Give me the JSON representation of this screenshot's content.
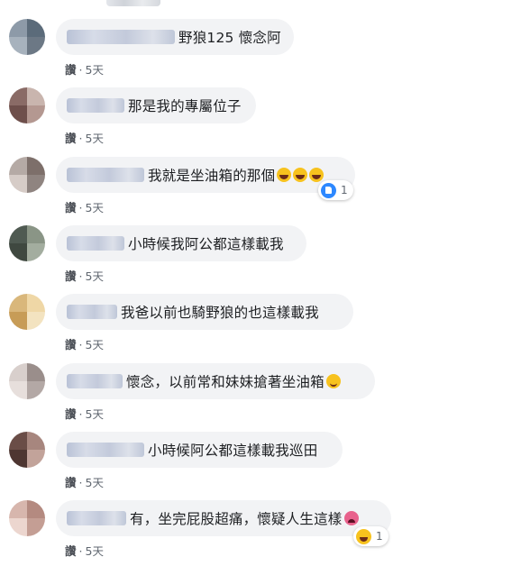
{
  "comments": [
    {
      "text": "野狼125 懷念阿",
      "meta": {
        "like": "讚",
        "sep": "·",
        "time": "5天"
      },
      "emojis": [],
      "reaction": null,
      "avatar": [
        "#8d9aa8",
        "#5b6b7a",
        "#a7b2bd",
        "#6c7885"
      ]
    },
    {
      "text": "那是我的專屬位子",
      "meta": {
        "like": "讚",
        "sep": "·",
        "time": "5天"
      },
      "emojis": [],
      "reaction": null,
      "avatar": [
        "#8a6b66",
        "#c9b5ae",
        "#6e4f4b",
        "#b49891"
      ]
    },
    {
      "text": "我就是坐油箱的那個",
      "meta": {
        "like": "讚",
        "sep": "·",
        "time": "5天"
      },
      "emojis": [
        "laugh",
        "laugh",
        "laugh"
      ],
      "reaction": {
        "icon": "like-blue",
        "count": "1"
      },
      "avatar": [
        "#b5aaa5",
        "#7d6f6a",
        "#d6ccc7",
        "#8f8480"
      ]
    },
    {
      "text": "小時候我阿公都這樣載我",
      "meta": {
        "like": "讚",
        "sep": "·",
        "time": "5天"
      },
      "emojis": [],
      "reaction": null,
      "avatar": [
        "#4f5a52",
        "#8a9586",
        "#3f4840",
        "#a3ad9f"
      ]
    },
    {
      "text": "我爸以前也騎野狼的也這樣載我",
      "meta": {
        "like": "讚",
        "sep": "·",
        "time": "5天"
      },
      "emojis": [],
      "reaction": null,
      "avatar": [
        "#d9b77b",
        "#efd7a6",
        "#c79c57",
        "#f3e3c0"
      ]
    },
    {
      "text": "懷念，以前常和妹妹搶著坐油箱",
      "meta": {
        "like": "讚",
        "sep": "·",
        "time": "5天"
      },
      "emojis": [
        "smile"
      ],
      "reaction": null,
      "avatar": [
        "#d8cfcc",
        "#9a8e8b",
        "#e7dfdc",
        "#b3a8a5"
      ]
    },
    {
      "text": "小時候阿公都這樣載我巡田",
      "meta": {
        "like": "讚",
        "sep": "·",
        "time": "5天"
      },
      "emojis": [],
      "reaction": null,
      "avatar": [
        "#6a4d47",
        "#a7867e",
        "#4e3631",
        "#c2a39a"
      ]
    },
    {
      "text": "有，坐完屁股超痛，懷疑人生這樣",
      "meta": {
        "like": "讚",
        "sep": "·",
        "time": "5天"
      },
      "emojis": [
        "tired"
      ],
      "reaction": {
        "icon": "haha",
        "count": "1"
      },
      "avatar": [
        "#d7b6ad",
        "#b48a80",
        "#ecd6cf",
        "#c49e94"
      ]
    }
  ]
}
